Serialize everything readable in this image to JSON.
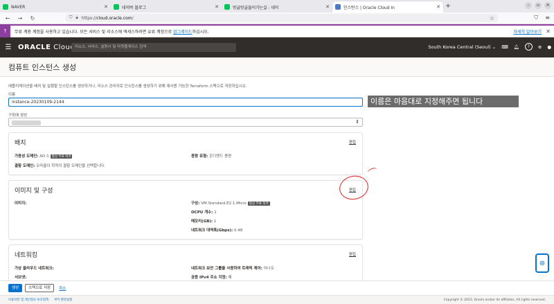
{
  "browser": {
    "tabs": [
      {
        "title": "NAVER",
        "active": false,
        "favicon": "naver-favicon"
      },
      {
        "title": "네이버 블로그",
        "active": false,
        "favicon": "naver-favicon"
      },
      {
        "title": "방글방글들이가는실 : 네이",
        "active": false,
        "favicon": "naver-favicon"
      },
      {
        "title": "인스턴스 | Oracle Cloud In",
        "active": true,
        "favicon": "oracle-cloud-favicon"
      }
    ],
    "new_tab": "+",
    "url": "https://cloud.oracle.com/",
    "url_host_bold": "cloud.oracle.com"
  },
  "announcement": {
    "text_before": "무료 계층 계정을 사용하고 있습니다. 모든 서비스 및 리소스에 액세스하려면 유료 계정으로 ",
    "link": "업그레이드",
    "text_after": "하십시오.",
    "more": "자세히 알아보기"
  },
  "header": {
    "brand_bold": "ORACLE",
    "brand": " Cloud",
    "search_placeholder": "리소스, 서비스, 설명서 및 마켓플레이스 검색",
    "region": "South Korea Central (Seoul)"
  },
  "page": {
    "title": "컴퓨트 인스턴스 생성",
    "description": "애플리케이션을 배치 및 실행할 인스턴스를 생성하거나, 리소스 관리자로 인스턴스를 생성하기 위해 재사용 가능한 Terraform 스택으로 저장하십시오.",
    "name_label": "이름",
    "name_value": "instance-20230109-2144",
    "annotation": "이름은 마음대로 지정해주면 됩니다",
    "compartment_label": "구획에 생성"
  },
  "placement": {
    "title": "배치",
    "edit": "편집",
    "ad_label": "가용성 도메인:",
    "ad_value": "AD-1",
    "ad_tag": "항상 무료 적격",
    "capacity_label": "용량 유형:",
    "capacity_value": "온디맨드 용량",
    "fault_label": "결함 도메인:",
    "fault_value": "오라클이 최적의 결함 도메인을 선택합니다."
  },
  "image_shape": {
    "title": "이미지 및 구성",
    "edit": "편집",
    "image_label": "이미지:",
    "shape_label": "구성:",
    "shape_value": "VM.Standard.E2.1.Micro",
    "shape_tag": "항상 무료 적격",
    "ocpu_label": "OCPU 개수:",
    "ocpu_value": "1",
    "memory_label": "메모리(GB):",
    "memory_value": "1",
    "bandwidth_label": "네트워크 대역폭(Gbps):",
    "bandwidth_value": "0.48"
  },
  "networking": {
    "title": "네트워킹",
    "edit": "편집",
    "vcn_label": "가상 클라우드 네트워크:",
    "nsg_label": "네트워크 보안 그룹을 사용하여 트래픽 제어:",
    "nsg_value": "아니오",
    "subnet_label": "서브넷:",
    "ipv4_label": "공용 IPv4 주소 지정:",
    "ipv4_value": "예"
  },
  "actions": {
    "create": "생성",
    "save_stack": "스택으로 저장",
    "cancel": "취소"
  },
  "footer": {
    "terms": "이용약관 및 개인정보 보호정책",
    "cookie": "쿠키 환경설정",
    "copyright": "Copyright © 2023, Oracle and/or its affiliates. All rights reserved."
  },
  "colors": {
    "header_bg": "#312d2a",
    "accent": "#0572ce",
    "announce": "#8d3fa0",
    "annotation_red": "#e0201a"
  }
}
